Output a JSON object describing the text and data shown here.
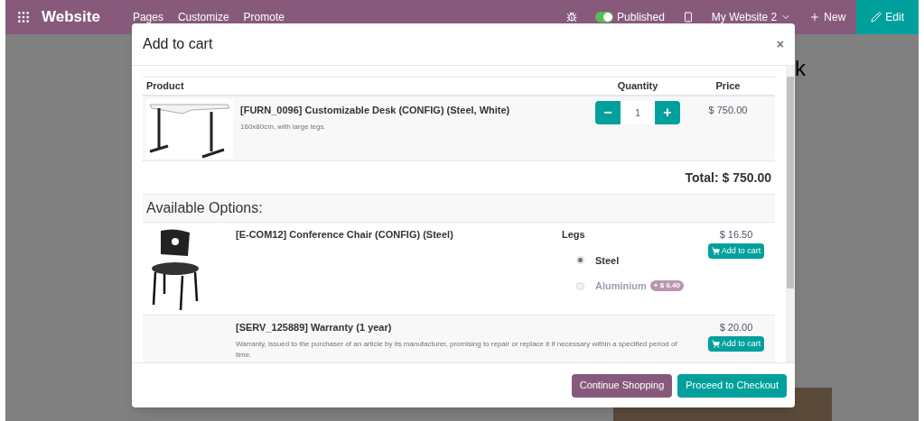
{
  "navbar": {
    "app_name": "Website",
    "menu": [
      "Pages",
      "Customize",
      "Promote"
    ],
    "published": {
      "label": "Published",
      "on": true
    },
    "website": "My Website 2",
    "new_label": "New",
    "edit_label": "Edit"
  },
  "background": {
    "heading_fragment": "k"
  },
  "modal": {
    "title": "Add to cart",
    "close": "×",
    "columns": [
      "Product",
      "Quantity",
      "Price"
    ],
    "cart_item": {
      "name": "[FURN_0096] Customizable Desk (CONFIG) (Steel, White)",
      "description": "160x80cm, with large legs.",
      "quantity": "1",
      "minus": "−",
      "plus": "+",
      "price": "$ 750.00"
    },
    "total": "Total: $ 750.00",
    "options_heading": "Available Options:",
    "options": [
      {
        "name": "[E-COM12] Conference Chair (CONFIG) (Steel)",
        "image": true,
        "attribute": "Legs",
        "values": [
          {
            "label": "Steel",
            "selected": true
          },
          {
            "label": "Aluminium",
            "selected": false,
            "extra": "+ $ 6.40"
          }
        ],
        "price": "$ 16.50",
        "button": "Add to cart"
      },
      {
        "name": "[SERV_125889] Warranty (1 year)",
        "image": false,
        "description": "Warranty, issued to the purchaser of an article by its manufacturer, promising to repair or replace it if necessary within a specified period of time.",
        "price": "$ 20.00",
        "button": "Add to cart"
      }
    ],
    "footer": [
      "Continue Shopping",
      "Proceed to Checkout"
    ]
  }
}
